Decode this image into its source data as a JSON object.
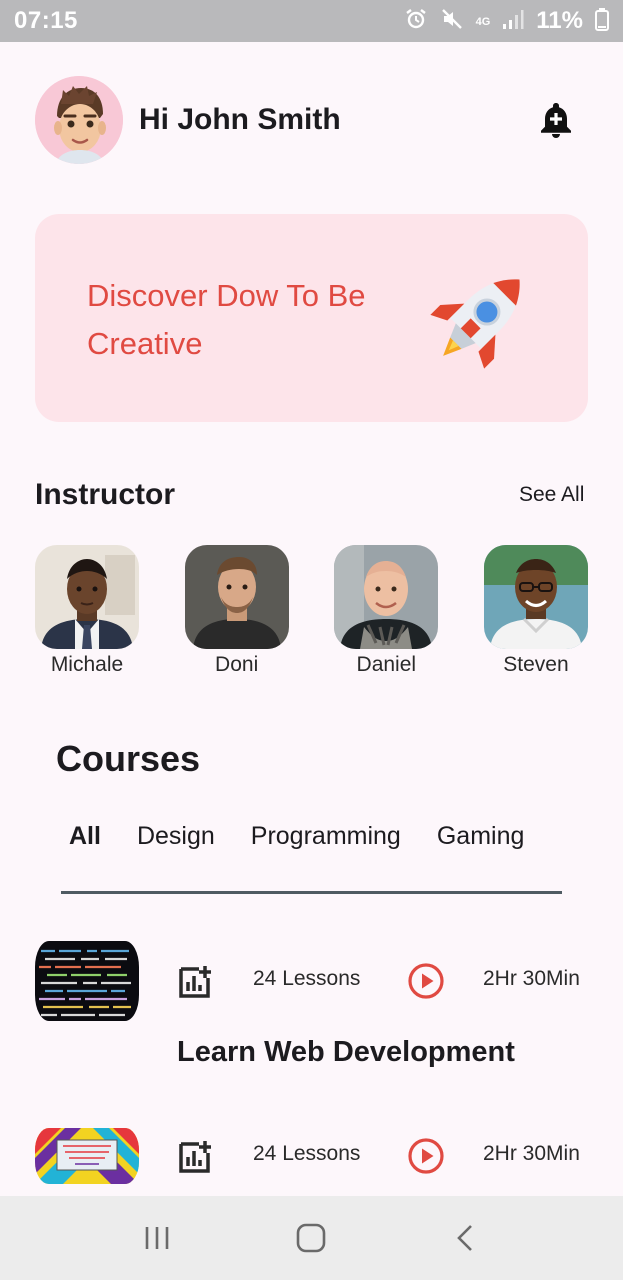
{
  "status_bar": {
    "time": "07:15",
    "network": "4G",
    "battery": "11%",
    "icons": [
      "alarm-icon",
      "mute-icon",
      "network-4g-icon",
      "signal-icon",
      "battery-icon"
    ]
  },
  "header": {
    "greeting": "Hi John Smith",
    "avatar_icon": "memoji-avatar-icon",
    "action_icon": "add-alert-bell-icon"
  },
  "promo": {
    "text": "Discover Dow To Be Creative",
    "icon": "rocket-icon"
  },
  "instructor_section": {
    "title": "Instructor",
    "see_all": "See All",
    "instructors": [
      {
        "name": "Michale"
      },
      {
        "name": "Doni"
      },
      {
        "name": "Daniel"
      },
      {
        "name": "Steven"
      }
    ]
  },
  "courses_section": {
    "title": "Courses",
    "tabs": [
      {
        "label": "All",
        "active": true
      },
      {
        "label": "Design",
        "active": false
      },
      {
        "label": "Programming",
        "active": false
      },
      {
        "label": "Gaming",
        "active": false
      }
    ],
    "courses": [
      {
        "name": "Learn Web Development",
        "lessons": "24 Lessons",
        "duration": "2Hr 30Min"
      },
      {
        "name": "",
        "lessons": "24 Lessons",
        "duration": "2Hr 30Min"
      }
    ]
  },
  "nav_bar": {
    "icons": [
      "recent-apps-icon",
      "home-icon",
      "back-icon"
    ]
  },
  "colors": {
    "accent_red": "#e04a42",
    "promo_bg": "#fde4ea",
    "page_bg": "#fdf7fb",
    "tab_underline": "#4f5b62"
  }
}
